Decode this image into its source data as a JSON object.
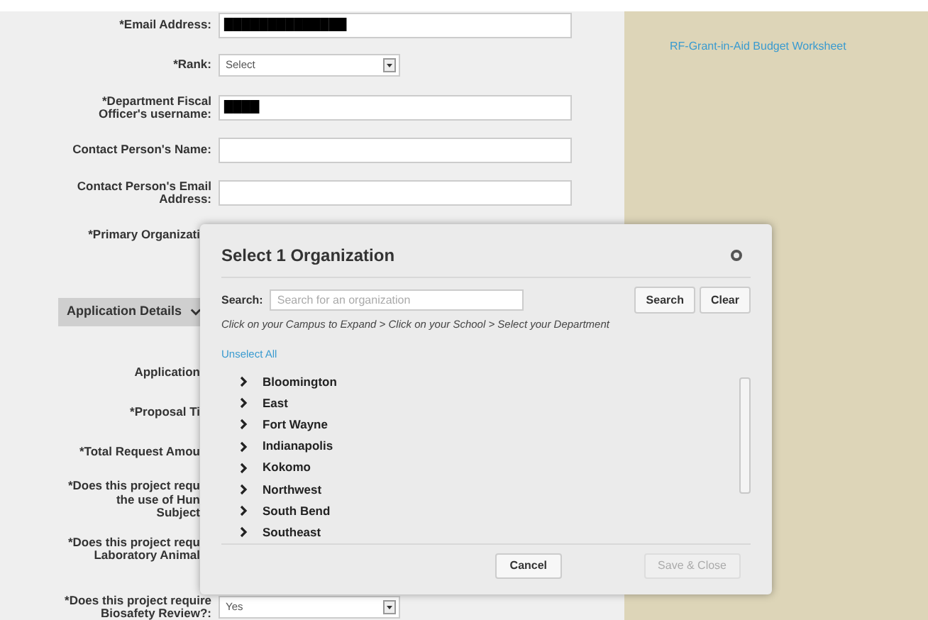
{
  "sidebar_link": "RF-Grant-in-Aid Budget Worksheet",
  "form_fields": [
    {
      "kind": "text",
      "label": [
        "*Email Address:"
      ],
      "value": "██████████████"
    },
    {
      "kind": "select",
      "label": [
        "*Rank:"
      ],
      "value": "Select"
    },
    {
      "kind": "text",
      "label": [
        "*Department Fiscal",
        "Officer's username:"
      ],
      "value": "████"
    },
    {
      "kind": "text",
      "label": [
        "Contact Person's Name:"
      ]
    },
    {
      "kind": "text",
      "label": [
        "Contact Person's Email",
        "Address:"
      ]
    },
    {
      "kind": "label",
      "label": [
        "*Primary Organizati"
      ]
    }
  ],
  "section": {
    "title": "Application Details",
    "expanded": true
  },
  "section_fields": [
    {
      "kind": "label",
      "label": [
        "Application"
      ]
    },
    {
      "kind": "label",
      "label": [
        "*Proposal Ti"
      ]
    },
    {
      "kind": "label",
      "label": [
        "*Total Request Amou"
      ]
    },
    {
      "kind": "label",
      "label": [
        "*Does this project requ",
        "the use of Hun",
        "Subject"
      ]
    },
    {
      "kind": "label",
      "label": [
        "*Does this project requ",
        "Laboratory Animal"
      ]
    },
    {
      "kind": "select",
      "label": [
        "*Does this project require",
        "Biosafety Review?:"
      ],
      "value": "Yes"
    }
  ],
  "dialog": {
    "title": "Select 1 Organization",
    "search_label": "Search:",
    "search_placeholder": "Search for an organization",
    "search_button": "Search",
    "clear_button": "Clear",
    "instructions": "Click on your Campus to Expand > Click on your School > Select your Department",
    "unselect_all": "Unselect All",
    "items": [
      {
        "label": "Bloomington",
        "expanded": false
      },
      {
        "label": "East",
        "expanded": false
      },
      {
        "label": "Fort Wayne",
        "expanded": false
      },
      {
        "label": "Indianapolis",
        "expanded": false
      },
      {
        "label": "Kokomo",
        "expanded": false
      },
      {
        "label": "Northwest",
        "expanded": false
      },
      {
        "label": "South Bend",
        "expanded": false
      },
      {
        "label": "Southeast",
        "expanded": false
      }
    ],
    "cancel_button": "Cancel",
    "save_button": {
      "label": "Save & Close",
      "disabled": true
    }
  }
}
